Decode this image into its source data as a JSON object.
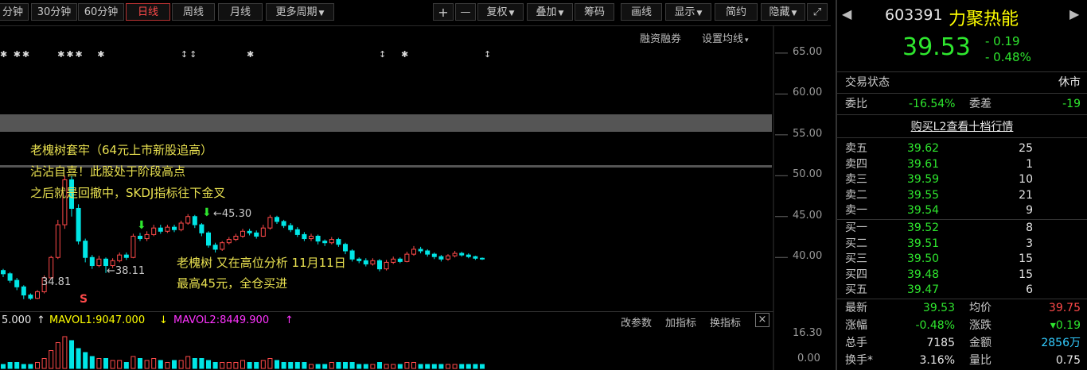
{
  "toolbar": {
    "periods": [
      "分钟",
      "30分钟",
      "60分钟",
      "日线",
      "周线",
      "月线",
      "更多周期"
    ],
    "active_period": "日线",
    "tools": [
      "+",
      "—",
      "复权",
      "叠加",
      "筹码",
      "画线",
      "显示",
      "简约",
      "隐藏"
    ],
    "expand_icon": "expand-icon"
  },
  "chart_links": {
    "margin": "融资融券",
    "ma": "设置均线"
  },
  "annotation1": [
    "老槐树套牢（64元上市新股追高）",
    "沾沾自喜！此股处于阶段高点",
    "之后就是回撤中，SKDJ指标往下金叉"
  ],
  "annotation2": [
    "老槐树 又在高位分析 11月11日",
    "最高45元，全仓买进"
  ],
  "price_labels": {
    "high": "←45.30",
    "mid": "←38.11",
    "low": "34.81"
  },
  "s_marker": "S",
  "volume_bar": {
    "left_value": "5.000",
    "mavol1": "MAVOL1:9047.000",
    "mavol2": "MAVOL2:8449.900",
    "buttons": [
      "改参数",
      "加指标",
      "换指标"
    ],
    "close": "×",
    "ytick": "16.30",
    "ytick2": "0.00"
  },
  "colors": {
    "up": "#ff4a4a",
    "down": "#00e6e6",
    "mavol1": "#ffff00",
    "mavol2": "#ff33ff"
  },
  "chart_data": {
    "type": "candlestick",
    "ylim": [
      34,
      68
    ],
    "yticks": [
      65.0,
      60.0,
      55.0,
      50.0,
      45.0,
      40.0
    ],
    "ytick_labels": [
      "65.00",
      "60.00",
      "55.00",
      "50.00",
      "45.00",
      "40.00"
    ],
    "candles": [
      {
        "o": 38.4,
        "c": 38.0,
        "h": 38.6,
        "l": 37.6
      },
      {
        "o": 38.0,
        "c": 37.2,
        "h": 38.2,
        "l": 36.9
      },
      {
        "o": 37.2,
        "c": 36.4,
        "h": 37.5,
        "l": 36.0
      },
      {
        "o": 36.4,
        "c": 35.4,
        "h": 36.6,
        "l": 34.9
      },
      {
        "o": 35.4,
        "c": 35.0,
        "h": 35.6,
        "l": 34.81
      },
      {
        "o": 35.0,
        "c": 35.8,
        "h": 36.0,
        "l": 34.9
      },
      {
        "o": 35.8,
        "c": 37.5,
        "h": 37.8,
        "l": 35.6
      },
      {
        "o": 37.5,
        "c": 40.0,
        "h": 40.2,
        "l": 37.4
      },
      {
        "o": 40.0,
        "c": 44.0,
        "h": 44.6,
        "l": 39.8
      },
      {
        "o": 44.0,
        "c": 49.5,
        "h": 50.0,
        "l": 43.5
      },
      {
        "o": 49.5,
        "c": 46.0,
        "h": 50.0,
        "l": 45.0
      },
      {
        "o": 46.0,
        "c": 42.0,
        "h": 46.5,
        "l": 41.6
      },
      {
        "o": 42.0,
        "c": 40.0,
        "h": 42.3,
        "l": 39.4
      },
      {
        "o": 40.0,
        "c": 39.0,
        "h": 40.3,
        "l": 38.6
      },
      {
        "o": 39.0,
        "c": 39.8,
        "h": 40.2,
        "l": 38.8
      },
      {
        "o": 39.8,
        "c": 39.0,
        "h": 40.0,
        "l": 38.11
      },
      {
        "o": 39.0,
        "c": 39.6,
        "h": 39.9,
        "l": 38.7
      },
      {
        "o": 39.6,
        "c": 40.3,
        "h": 40.6,
        "l": 39.4
      },
      {
        "o": 40.3,
        "c": 40.0,
        "h": 40.6,
        "l": 39.7
      },
      {
        "o": 40.0,
        "c": 42.6,
        "h": 42.9,
        "l": 39.9
      },
      {
        "o": 42.6,
        "c": 42.3,
        "h": 43.0,
        "l": 42.0
      },
      {
        "o": 42.3,
        "c": 42.8,
        "h": 43.2,
        "l": 42.0
      },
      {
        "o": 42.8,
        "c": 43.6,
        "h": 44.0,
        "l": 42.6
      },
      {
        "o": 43.6,
        "c": 43.2,
        "h": 44.0,
        "l": 42.9
      },
      {
        "o": 43.2,
        "c": 43.7,
        "h": 44.0,
        "l": 43.0
      },
      {
        "o": 43.7,
        "c": 43.4,
        "h": 44.0,
        "l": 43.1
      },
      {
        "o": 43.4,
        "c": 44.2,
        "h": 44.5,
        "l": 43.2
      },
      {
        "o": 44.2,
        "c": 45.0,
        "h": 45.3,
        "l": 44.0
      },
      {
        "o": 45.0,
        "c": 44.0,
        "h": 45.2,
        "l": 43.6
      },
      {
        "o": 44.0,
        "c": 43.0,
        "h": 44.2,
        "l": 42.6
      },
      {
        "o": 43.0,
        "c": 41.5,
        "h": 43.2,
        "l": 41.2
      },
      {
        "o": 41.5,
        "c": 41.0,
        "h": 41.8,
        "l": 40.6
      },
      {
        "o": 41.0,
        "c": 41.8,
        "h": 42.0,
        "l": 40.8
      },
      {
        "o": 41.8,
        "c": 42.2,
        "h": 42.5,
        "l": 41.6
      },
      {
        "o": 42.2,
        "c": 42.6,
        "h": 42.9,
        "l": 42.0
      },
      {
        "o": 42.6,
        "c": 43.2,
        "h": 43.5,
        "l": 42.4
      },
      {
        "o": 43.2,
        "c": 43.0,
        "h": 43.5,
        "l": 42.7
      },
      {
        "o": 43.0,
        "c": 42.6,
        "h": 43.3,
        "l": 42.3
      },
      {
        "o": 42.6,
        "c": 43.6,
        "h": 44.0,
        "l": 42.5
      },
      {
        "o": 43.6,
        "c": 44.9,
        "h": 45.2,
        "l": 43.4
      },
      {
        "o": 44.9,
        "c": 44.4,
        "h": 45.1,
        "l": 44.1
      },
      {
        "o": 44.4,
        "c": 43.9,
        "h": 44.6,
        "l": 43.6
      },
      {
        "o": 43.9,
        "c": 43.4,
        "h": 44.2,
        "l": 43.1
      },
      {
        "o": 43.4,
        "c": 42.8,
        "h": 43.7,
        "l": 42.5
      },
      {
        "o": 42.8,
        "c": 42.3,
        "h": 43.1,
        "l": 42.0
      },
      {
        "o": 42.3,
        "c": 42.6,
        "h": 42.9,
        "l": 42.0
      },
      {
        "o": 42.6,
        "c": 42.0,
        "h": 42.8,
        "l": 41.6
      },
      {
        "o": 42.0,
        "c": 41.8,
        "h": 42.2,
        "l": 41.4
      },
      {
        "o": 41.8,
        "c": 42.2,
        "h": 42.5,
        "l": 41.6
      },
      {
        "o": 42.2,
        "c": 41.6,
        "h": 42.4,
        "l": 41.3
      },
      {
        "o": 41.6,
        "c": 40.8,
        "h": 41.8,
        "l": 40.4
      },
      {
        "o": 40.8,
        "c": 39.8,
        "h": 41.0,
        "l": 39.5
      },
      {
        "o": 39.8,
        "c": 39.6,
        "h": 40.0,
        "l": 39.3
      },
      {
        "o": 39.6,
        "c": 39.2,
        "h": 39.9,
        "l": 38.9
      },
      {
        "o": 39.2,
        "c": 39.6,
        "h": 39.9,
        "l": 39.0
      },
      {
        "o": 39.6,
        "c": 38.6,
        "h": 39.8,
        "l": 38.3
      },
      {
        "o": 38.6,
        "c": 39.4,
        "h": 39.7,
        "l": 38.4
      },
      {
        "o": 39.4,
        "c": 39.8,
        "h": 40.1,
        "l": 39.2
      },
      {
        "o": 39.8,
        "c": 39.5,
        "h": 40.0,
        "l": 39.3
      },
      {
        "o": 39.5,
        "c": 40.4,
        "h": 40.7,
        "l": 39.4
      },
      {
        "o": 40.4,
        "c": 41.0,
        "h": 41.4,
        "l": 40.2
      },
      {
        "o": 41.0,
        "c": 40.8,
        "h": 41.3,
        "l": 40.5
      },
      {
        "o": 40.8,
        "c": 40.4,
        "h": 41.0,
        "l": 40.1
      },
      {
        "o": 40.4,
        "c": 40.1,
        "h": 40.6,
        "l": 39.8
      },
      {
        "o": 40.1,
        "c": 39.8,
        "h": 40.3,
        "l": 39.5
      },
      {
        "o": 39.8,
        "c": 40.2,
        "h": 40.4,
        "l": 39.6
      },
      {
        "o": 40.2,
        "c": 40.5,
        "h": 40.8,
        "l": 40.0
      },
      {
        "o": 40.5,
        "c": 40.3,
        "h": 40.7,
        "l": 40.1
      },
      {
        "o": 40.3,
        "c": 40.1,
        "h": 40.5,
        "l": 39.9
      },
      {
        "o": 40.1,
        "c": 39.9,
        "h": 40.2,
        "l": 39.7
      },
      {
        "o": 39.9,
        "c": 39.8,
        "h": 40.0,
        "l": 39.7
      }
    ],
    "volumes": [
      2,
      3,
      3,
      2,
      2,
      3,
      5,
      9,
      13,
      16,
      14,
      10,
      8,
      6,
      5,
      5,
      4,
      4,
      3,
      6,
      5,
      4,
      5,
      4,
      3,
      4,
      4,
      6,
      5,
      5,
      4,
      3,
      3,
      3,
      3,
      4,
      3,
      3,
      4,
      5,
      4,
      3,
      3,
      3,
      3,
      2,
      2,
      2,
      3,
      3,
      3,
      3,
      2,
      2,
      2,
      3,
      2,
      2,
      2,
      3,
      3,
      2,
      2,
      2,
      2,
      2,
      2,
      2,
      2,
      2,
      2
    ]
  },
  "panel": {
    "code": "603391",
    "name": "力聚热能",
    "price": "39.53",
    "change": "- 0.19",
    "change_pct": "- 0.48%",
    "status_label": "交易状态",
    "status_value": "休市",
    "ratio_label": "委比",
    "ratio_value": "-16.54%",
    "diff_label": "委差",
    "diff_value": "-19",
    "l2_link": "购买L2查看十档行情",
    "asks": [
      {
        "label": "卖五",
        "price": "39.62",
        "vol": "25"
      },
      {
        "label": "卖四",
        "price": "39.61",
        "vol": "1"
      },
      {
        "label": "卖三",
        "price": "39.59",
        "vol": "10"
      },
      {
        "label": "卖二",
        "price": "39.55",
        "vol": "21"
      },
      {
        "label": "卖一",
        "price": "39.54",
        "vol": "9"
      }
    ],
    "bids": [
      {
        "label": "买一",
        "price": "39.52",
        "vol": "8"
      },
      {
        "label": "买二",
        "price": "39.51",
        "vol": "3"
      },
      {
        "label": "买三",
        "price": "39.50",
        "vol": "15"
      },
      {
        "label": "买四",
        "price": "39.48",
        "vol": "15"
      },
      {
        "label": "买五",
        "price": "39.47",
        "vol": "6"
      }
    ],
    "stats": [
      {
        "l1": "最新",
        "v1": "39.53",
        "l2": "均价",
        "v2": "39.75"
      },
      {
        "l1": "涨幅",
        "v1": "-0.48%",
        "l2": "涨跌",
        "v2": "▾0.19"
      },
      {
        "l1": "总手",
        "v1": "7185",
        "l2": "金额",
        "v2": "2856万"
      },
      {
        "l1": "换手*",
        "v1": "3.16%",
        "l2": "量比",
        "v2": "0.75"
      }
    ]
  }
}
